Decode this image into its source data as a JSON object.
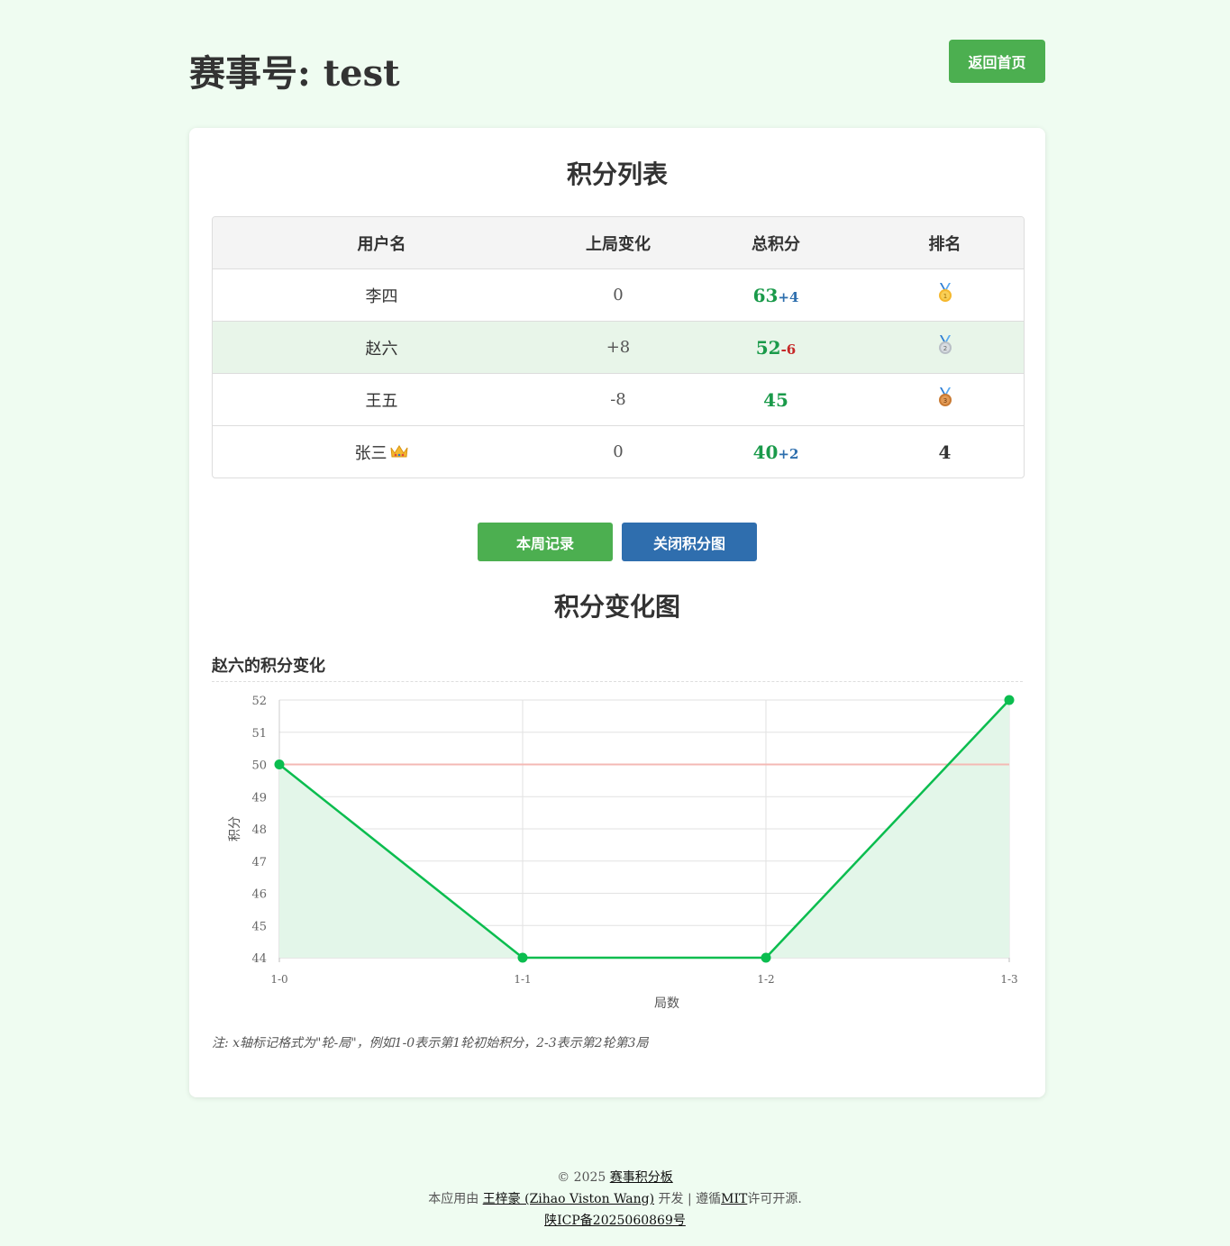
{
  "header": {
    "title": "赛事号: test",
    "home_button": "返回首页"
  },
  "score_table": {
    "title": "积分列表",
    "columns": [
      "用户名",
      "上局变化",
      "总积分",
      "排名"
    ],
    "rows": [
      {
        "name": "李四",
        "last_change": "0",
        "total": "63",
        "delta": "+4",
        "rank": "1",
        "rank_icon": "gold-medal-icon"
      },
      {
        "name": "赵六",
        "last_change": "+8",
        "total": "52",
        "delta": "-6",
        "rank": "2",
        "rank_icon": "silver-medal-icon"
      },
      {
        "name": "王五",
        "last_change": "-8",
        "total": "45",
        "delta": "",
        "rank": "3",
        "rank_icon": "bronze-medal-icon"
      },
      {
        "name": "张三",
        "last_change": "0",
        "total": "40",
        "delta": "+2",
        "rank": "4",
        "rank_icon": "",
        "name_icon": "crown-icon"
      }
    ]
  },
  "buttons": {
    "week_record": "本周记录",
    "close_chart": "关闭积分图"
  },
  "chart_section": {
    "title": "积分变化图",
    "subtitle": "赵六的积分变化",
    "note": "注: x轴标记格式为\"轮-局\"，例如1-0表示第1轮初始积分，2-3表示第2轮第3局"
  },
  "chart_data": {
    "type": "line",
    "x": [
      "1-0",
      "1-1",
      "1-2",
      "1-3"
    ],
    "values": [
      50,
      44,
      44,
      52
    ],
    "xlabel": "局数",
    "ylabel": "积分",
    "ylim": [
      44,
      52
    ],
    "yticks": [
      "44",
      "45",
      "46",
      "47",
      "48",
      "49",
      "50",
      "51",
      "52"
    ],
    "reference_line": 50,
    "grid": true,
    "line_color": "#0bbd4f",
    "fill_color": "#e3f6e9",
    "reference_color": "#f4b9b4"
  },
  "footer": {
    "copyright_prefix": "© 2025",
    "site_link": "赛事积分板",
    "dev_prefix": "本应用由",
    "author_link": "王梓豪 (Zihao Viston Wang)",
    "dev_mid": "开发 | 遵循",
    "license_link": "MIT",
    "dev_suffix": "许可开源.",
    "icp_link": "陕ICP备2025060869号"
  }
}
